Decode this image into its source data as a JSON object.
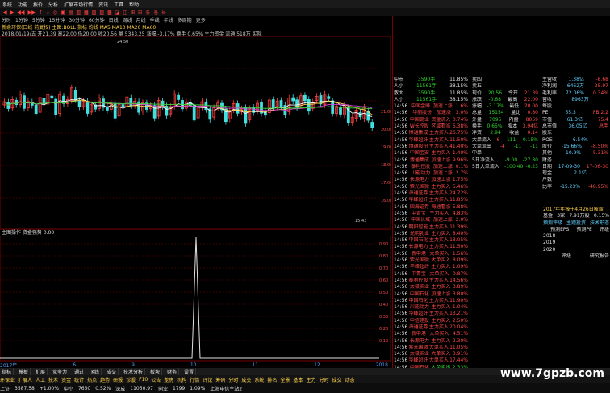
{
  "menu": [
    "系统",
    "功能",
    "报价",
    "分析",
    "扩展市场行情",
    "资讯",
    "工具",
    "帮助"
  ],
  "toolbar": [
    "◀",
    "▶",
    "◀◀",
    "▶▶",
    "↑",
    "↓",
    "◎",
    "▣",
    "▤",
    "▥",
    "▦",
    "▧",
    "▨",
    "▩",
    "◪",
    "◫",
    "⊞",
    "⊟",
    "多",
    "多",
    "号"
  ],
  "periods": [
    "分时",
    "1分钟",
    "5分钟",
    "15分钟",
    "30分钟",
    "60分钟",
    "日线",
    "周线",
    "月线",
    "季线",
    "年线",
    "多周期",
    "更多"
  ],
  "title": "新余环保(日线 前复权) 主图:BOLL  指标 均线 MA5 MA10 MA20 MA60",
  "info1": "2018/01/19/五  开21.39  高22.00  低20.00  收20.56  量 5343.25  涨幅 -3.17%  换手 0.65%  主力资金 流通 518万 实际",
  "subtitle": "主图操作 资金强势 0.00",
  "chart_data": {
    "type": "candlestick",
    "price_labels": [
      "21.00",
      "20.00",
      "19.00",
      "18.00",
      "17.00",
      "16.00"
    ],
    "annotations": [
      "24.50",
      "15.43"
    ],
    "sub_labels": [
      "0.90",
      "0.80",
      "0.70",
      "0.60",
      "0.50",
      "0.40",
      "0.30",
      "0.20",
      "0.10"
    ],
    "spike": 0.9
  },
  "ticker": [
    "11.05",
    "-1.67",
    "11.03",
    "14.59",
    "1.08",
    "1.42",
    "10.92",
    "15.89"
  ],
  "tabs": [
    "指标",
    "模板",
    "扩展",
    "竞争力",
    "通过",
    "K线",
    "成交",
    "技术分析",
    "板块",
    "财务",
    "设置"
  ],
  "tabs2": [
    "环保业",
    "扩展人",
    "人工",
    "技术",
    "资金",
    "统计",
    "热点",
    "趋势",
    "研报",
    "诊股",
    "F10",
    "公告",
    "龙虎",
    "机构",
    "行情",
    "评论",
    "筹码",
    "分时",
    "成交",
    "系统",
    "排名",
    "全景",
    "基本",
    "主力",
    "分时",
    "成交",
    "动态"
  ],
  "status": [
    "上证",
    "3587.58",
    "+1.00%",
    "中小",
    "7650",
    "0.52%",
    "深成",
    "11050.97",
    "创业",
    "1799",
    "1.09%",
    "上海电信主站2"
  ],
  "mid_top": [
    [
      "中市",
      "3590手",
      "11.85%"
    ],
    [
      "人小",
      "11561手",
      "38.15%"
    ],
    [
      "散大",
      "3590手",
      "11.85%"
    ],
    [
      "人小",
      "11561手",
      "38.15%"
    ]
  ],
  "mid_rows": [
    [
      "14:56",
      "中国金峰",
      "加速上涨",
      "1.6%"
    ],
    [
      "14:56",
      "华丽股份",
      "加速涨",
      "3.0%"
    ],
    [
      "14:56",
      "中国锡业",
      "资金流入",
      "0.74%"
    ],
    [
      "14:56",
      "W长控股",
      "区域看涨",
      "5.38%"
    ],
    [
      "14:56",
      "博通集成",
      "主力买入",
      "26.75%"
    ],
    [
      "14:56",
      "华峰超纤",
      "主力买入",
      "11.50%"
    ],
    [
      "14:56",
      "博通股份",
      "主力买入",
      "41.40%"
    ],
    [
      "14:56",
      "中国宝安",
      "主力买入",
      "1.40%"
    ],
    [
      "14:56",
      "博通集成",
      "加速上涨",
      "9.96%"
    ],
    [
      "14:56",
      "泰利控股",
      "加速上涨",
      "0.1%"
    ],
    [
      "14:56",
      "川能动力",
      "加速上涨",
      "2.7%"
    ],
    [
      "14:56",
      "长源电力",
      "加速上涨",
      "1.75%"
    ],
    [
      "14:56",
      "紫光国微",
      "主力买入",
      "5.46%"
    ],
    [
      "14:56",
      "海通证券",
      "主力买入",
      "24.72%"
    ],
    [
      "14:56",
      "华峰超纤",
      "主力买入",
      "11.85%"
    ],
    [
      "14:56",
      "国海证券",
      "海通看涨",
      "5.88%"
    ],
    [
      "14:56",
      "中青宝",
      "主力买入",
      "4.83%"
    ],
    [
      "14:56",
      "中国长城",
      "加速上涨",
      "2.0%"
    ],
    [
      "14:56",
      "明阳智能",
      "主力买入",
      "11.39%"
    ],
    [
      "14:56",
      "光明乳业",
      "主力买入",
      "8.40%"
    ],
    [
      "14:56",
      "中国石化",
      "主力买入",
      "13.05%"
    ],
    [
      "14:56",
      "长源电力",
      "主力买入",
      "11.50%"
    ],
    [
      "14:56",
      "新中港",
      "大单买入",
      "1.56%"
    ],
    [
      "14:56",
      "紫光国微",
      "大单买入",
      "8.09%"
    ],
    [
      "14:56",
      "华峰超纤",
      "主力买入",
      "1.09%"
    ],
    [
      "14:56",
      "中青宝",
      "大单买入",
      "0.87%"
    ],
    [
      "14:56",
      "泰利控股",
      "主力买入",
      "14.56%"
    ],
    [
      "14:56",
      "太极实业",
      "主力买入",
      "3.89%"
    ],
    [
      "14:56",
      "中国石化",
      "加速上涨",
      "3.80%"
    ],
    [
      "14:56",
      "中国石化",
      "主力买入",
      "11.90%"
    ],
    [
      "14:56",
      "川能动力",
      "主力买入",
      "1.04%"
    ],
    [
      "14:56",
      "华峰超纤",
      "主力买入",
      "13.21%"
    ],
    [
      "14:56",
      "中信建投",
      "主力买入",
      "2.50%"
    ],
    [
      "14:56",
      "海通证券",
      "主力买入",
      "20.04%"
    ],
    [
      "14:56",
      "新中港",
      "大单买入",
      "4.51%"
    ],
    [
      "14:56",
      "长源电力",
      "主力买入",
      "2.30%"
    ],
    [
      "14:56",
      "紫光国微",
      "大单买入",
      "11.05%"
    ],
    [
      "14:56",
      "太极实业",
      "大单买入",
      "3.91%"
    ],
    [
      "14:56",
      "华峰超纤",
      "大单买入",
      "17.44%"
    ],
    [
      "14:56",
      "中国石化",
      "大单卖出",
      "2.33%"
    ],
    [
      "14:56",
      "海通证券",
      "大单买入",
      "4.53%"
    ],
    [
      "14:56",
      "中信建投",
      "大单卖出",
      "3.21%"
    ]
  ],
  "quote": [
    [
      "卖四",
      "",
      ""
    ],
    [
      "卖五",
      "",
      ""
    ],
    [
      "现价",
      "20.56",
      "今开",
      "21.39"
    ],
    [
      "涨跌",
      "-0.68",
      "最高",
      "22.00"
    ],
    [
      "涨幅",
      "-3.17%",
      "最低",
      "20.00"
    ],
    [
      "总量",
      "15154",
      "量比",
      "0.80"
    ],
    [
      "外盘",
      "7095",
      "内盘",
      "8059"
    ],
    [
      "换手",
      "0.65%",
      "股本",
      "3.94亿"
    ],
    [
      "净资",
      "2.94",
      "收益",
      "0.14"
    ]
  ],
  "quote_flow": [
    [
      "大单流入",
      "6",
      "-111",
      "-0.15%"
    ],
    [
      "大单流出",
      "-4",
      "-11",
      "-11"
    ],
    [
      "中单",
      "",
      "",
      ""
    ],
    [
      "5日净流入",
      "",
      "-9.00",
      "-27.80"
    ],
    [
      "5日大单流入",
      "",
      "-100.40",
      "-0.23"
    ]
  ],
  "fin": [
    [
      "主营收",
      "1.38亿",
      "-8.68"
    ],
    [
      "净利润",
      "6462万",
      "25.97"
    ],
    [
      "毛利率",
      "72.06%",
      "0.34%"
    ],
    [
      "营收",
      "8963万",
      ""
    ],
    [
      "每股",
      "",
      ""
    ],
    [
      "PE",
      "55.3",
      "PB 2.2"
    ],
    [
      "市值",
      "61.3亿",
      "75.4"
    ],
    [
      "总市值",
      "36.05亿",
      "总手"
    ],
    [
      "股东",
      "",
      ""
    ],
    [
      "ROE",
      "6.54%",
      ""
    ],
    [
      "股价",
      "-15.66%",
      "-8.50%"
    ],
    [
      "其他",
      "-10.9%",
      "5.31%"
    ],
    [
      "财务",
      "",
      ""
    ],
    [
      "日期",
      "17-09-30",
      "17-06-30"
    ],
    [
      "现金",
      "2.1亿",
      ""
    ],
    [
      "户数",
      "",
      ""
    ],
    [
      "比率",
      "-15.23%",
      "-48.95%"
    ]
  ],
  "report": {
    "head": "2017年年报于4月26日披露",
    "row1": [
      "基金",
      "3家",
      "7.91万股",
      "0.15%"
    ],
    "tabs": [
      "预测评级",
      "主题投资",
      "技术形态"
    ],
    "cols": [
      "",
      "预测EPS",
      "预测PE",
      "评级"
    ],
    "years": [
      "2018",
      "2019",
      "2020"
    ],
    "tabs2": [
      "",
      "评级",
      "研究报告"
    ]
  },
  "xlabels": [
    "2017年",
    "6",
    "9",
    "10",
    "11",
    "12",
    "2018"
  ],
  "watermark": "www.7gpzb.com"
}
